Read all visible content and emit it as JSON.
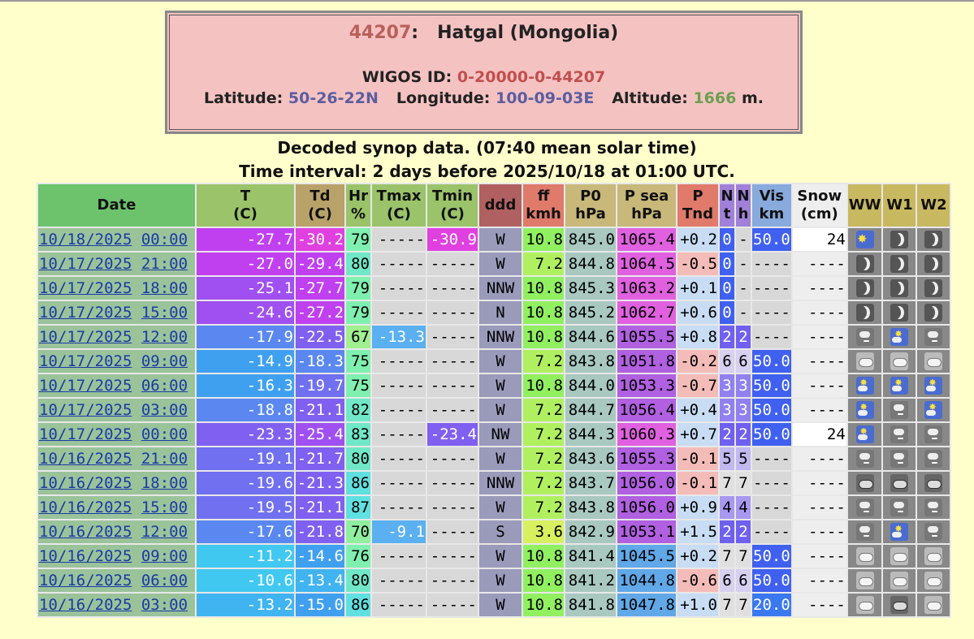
{
  "station": {
    "code": "44207",
    "separator": ":",
    "name": "Hatgal (Mongolia)",
    "wigos_label": "WIGOS ID:",
    "wigos_id": "0-20000-0-44207",
    "lat_label": "Latitude:",
    "lat": "50-26-22N",
    "lon_label": "Longitude:",
    "lon": "100-09-03E",
    "alt_label": "Altitude:",
    "alt": "1666",
    "alt_unit": "m."
  },
  "subtitle1": "Decoded synop data. (07:40 mean solar time)",
  "subtitle2": "Time interval: 2 days before 2025/10/18 at 01:00 UTC.",
  "headers": {
    "date": "Date",
    "T": [
      "T",
      "(C)"
    ],
    "Td": [
      "Td",
      "(C)"
    ],
    "Hr": [
      "Hr",
      "%"
    ],
    "Tmax": [
      "Tmax",
      "(C)"
    ],
    "Tmin": [
      "Tmin",
      "(C)"
    ],
    "ddd": "ddd",
    "ff": [
      "ff",
      "kmh"
    ],
    "P0": [
      "P0",
      "hPa"
    ],
    "Psea": [
      "P sea",
      "hPa"
    ],
    "PTnd": [
      "P",
      "Tnd"
    ],
    "Nt": [
      "N",
      "t"
    ],
    "Nh": [
      "N",
      "h"
    ],
    "Vis": [
      "Vis",
      "km"
    ],
    "Snow": [
      "Snow",
      "(cm)"
    ],
    "WW": "WW",
    "W1": "W1",
    "W2": "W2"
  },
  "rows": [
    {
      "date": "10/18/2025",
      "time": "00:00",
      "T": "-27.7",
      "Td": "-30.2",
      "Hr": "79",
      "Tmax": "-----",
      "Tmin": "-30.9",
      "ddd": "W",
      "ff": "10.8",
      "P0": "845.0",
      "Psea": "1065.4",
      "PTnd": "+0.2",
      "Nt": "0",
      "Nh": "-",
      "Vis": "50.0",
      "Snow": "24",
      "WW": "sun-icon",
      "W1": "moon-icon",
      "W2": "moon-icon"
    },
    {
      "date": "10/17/2025",
      "time": "21:00",
      "T": "-27.0",
      "Td": "-29.4",
      "Hr": "80",
      "Tmax": "-----",
      "Tmin": "-----",
      "ddd": "W",
      "ff": "7.2",
      "P0": "844.8",
      "Psea": "1064.5",
      "PTnd": "-0.5",
      "Nt": "0",
      "Nh": "-",
      "Vis": "----",
      "Snow": "----",
      "WW": "moon-icon",
      "W1": "moon-icon",
      "W2": "moon-icon"
    },
    {
      "date": "10/17/2025",
      "time": "18:00",
      "T": "-25.1",
      "Td": "-27.7",
      "Hr": "79",
      "Tmax": "-----",
      "Tmin": "-----",
      "ddd": "NNW",
      "ff": "10.8",
      "P0": "845.3",
      "Psea": "1063.2",
      "PTnd": "+0.1",
      "Nt": "0",
      "Nh": "-",
      "Vis": "----",
      "Snow": "----",
      "WW": "moon-icon",
      "W1": "moon-icon",
      "W2": "moon-icon"
    },
    {
      "date": "10/17/2025",
      "time": "15:00",
      "T": "-24.6",
      "Td": "-27.2",
      "Hr": "79",
      "Tmax": "-----",
      "Tmin": "-----",
      "ddd": "N",
      "ff": "10.8",
      "P0": "845.2",
      "Psea": "1062.7",
      "PTnd": "+0.6",
      "Nt": "0",
      "Nh": "-",
      "Vis": "----",
      "Snow": "----",
      "WW": "moon-icon",
      "W1": "moon-icon",
      "W2": "moon-icon"
    },
    {
      "date": "10/17/2025",
      "time": "12:00",
      "T": "-17.9",
      "Td": "-22.5",
      "Hr": "67",
      "Tmax": "-13.3",
      "Tmin": "-----",
      "ddd": "NNW",
      "ff": "10.8",
      "P0": "844.6",
      "Psea": "1055.5",
      "PTnd": "+0.8",
      "Nt": "2",
      "Nh": "2",
      "Vis": "----",
      "Snow": "----",
      "WW": "snow-icon",
      "W1": "sun-snow-icon",
      "W2": "snow-icon"
    },
    {
      "date": "10/17/2025",
      "time": "09:00",
      "T": "-14.9",
      "Td": "-18.3",
      "Hr": "75",
      "Tmax": "-----",
      "Tmin": "-----",
      "ddd": "W",
      "ff": "7.2",
      "P0": "843.8",
      "Psea": "1051.8",
      "PTnd": "-0.2",
      "Nt": "6",
      "Nh": "6",
      "Vis": "50.0",
      "Snow": "----",
      "WW": "cloud-icon",
      "W1": "cloud-icon",
      "W2": "cloud-icon"
    },
    {
      "date": "10/17/2025",
      "time": "06:00",
      "T": "-16.3",
      "Td": "-19.7",
      "Hr": "75",
      "Tmax": "-----",
      "Tmin": "-----",
      "ddd": "W",
      "ff": "10.8",
      "P0": "844.0",
      "Psea": "1053.3",
      "PTnd": "-0.7",
      "Nt": "3",
      "Nh": "3",
      "Vis": "50.0",
      "Snow": "----",
      "WW": "sun-snow-icon",
      "W1": "sun-snow-icon",
      "W2": "sun-snow-icon"
    },
    {
      "date": "10/17/2025",
      "time": "03:00",
      "T": "-18.8",
      "Td": "-21.1",
      "Hr": "82",
      "Tmax": "-----",
      "Tmin": "-----",
      "ddd": "W",
      "ff": "7.2",
      "P0": "844.7",
      "Psea": "1056.4",
      "PTnd": "+0.4",
      "Nt": "3",
      "Nh": "3",
      "Vis": "50.0",
      "Snow": "----",
      "WW": "sun-snow-icon",
      "W1": "snow-icon",
      "W2": "sun-snow-icon"
    },
    {
      "date": "10/17/2025",
      "time": "00:00",
      "T": "-23.3",
      "Td": "-25.4",
      "Hr": "83",
      "Tmax": "-----",
      "Tmin": "-23.4",
      "ddd": "NW",
      "ff": "7.2",
      "P0": "844.3",
      "Psea": "1060.3",
      "PTnd": "+0.7",
      "Nt": "2",
      "Nh": "2",
      "Vis": "50.0",
      "Snow": "24",
      "WW": "sun-snow-icon",
      "W1": "snow-icon",
      "W2": "snow-icon"
    },
    {
      "date": "10/16/2025",
      "time": "21:00",
      "T": "-19.1",
      "Td": "-21.7",
      "Hr": "80",
      "Tmax": "-----",
      "Tmin": "-----",
      "ddd": "W",
      "ff": "7.2",
      "P0": "843.6",
      "Psea": "1055.3",
      "PTnd": "-0.1",
      "Nt": "5",
      "Nh": "5",
      "Vis": "----",
      "Snow": "----",
      "WW": "snow-icon",
      "W1": "snow-icon",
      "W2": "snow-icon"
    },
    {
      "date": "10/16/2025",
      "time": "18:00",
      "T": "-19.6",
      "Td": "-21.3",
      "Hr": "86",
      "Tmax": "-----",
      "Tmin": "-----",
      "ddd": "NNW",
      "ff": "7.2",
      "P0": "843.7",
      "Psea": "1056.0",
      "PTnd": "-0.1",
      "Nt": "7",
      "Nh": "7",
      "Vis": "----",
      "Snow": "----",
      "WW": "dark-cloud-icon",
      "W1": "dark-cloud-icon",
      "W2": "dark-cloud-icon"
    },
    {
      "date": "10/16/2025",
      "time": "15:00",
      "T": "-19.5",
      "Td": "-21.1",
      "Hr": "87",
      "Tmax": "-----",
      "Tmin": "-----",
      "ddd": "W",
      "ff": "7.2",
      "P0": "843.8",
      "Psea": "1056.0",
      "PTnd": "+0.9",
      "Nt": "4",
      "Nh": "4",
      "Vis": "----",
      "Snow": "----",
      "WW": "snow-icon",
      "W1": "snow-icon",
      "W2": "snow-icon"
    },
    {
      "date": "10/16/2025",
      "time": "12:00",
      "T": "-17.6",
      "Td": "-21.8",
      "Hr": "70",
      "Tmax": "-9.1",
      "Tmin": "-----",
      "ddd": "S",
      "ff": "3.6",
      "P0": "842.9",
      "Psea": "1053.1",
      "PTnd": "+1.5",
      "Nt": "2",
      "Nh": "2",
      "Vis": "----",
      "Snow": "----",
      "WW": "snow-icon",
      "W1": "sun-snow-icon",
      "W2": "snow-icon"
    },
    {
      "date": "10/16/2025",
      "time": "09:00",
      "T": "-11.2",
      "Td": "-14.6",
      "Hr": "76",
      "Tmax": "-----",
      "Tmin": "-----",
      "ddd": "W",
      "ff": "10.8",
      "P0": "841.4",
      "Psea": "1045.5",
      "PTnd": "+0.2",
      "Nt": "7",
      "Nh": "7",
      "Vis": "50.0",
      "Snow": "----",
      "WW": "cloud-icon",
      "W1": "cloud-icon",
      "W2": "cloud-icon"
    },
    {
      "date": "10/16/2025",
      "time": "06:00",
      "T": "-10.6",
      "Td": "-13.4",
      "Hr": "80",
      "Tmax": "-----",
      "Tmin": "-----",
      "ddd": "W",
      "ff": "10.8",
      "P0": "841.2",
      "Psea": "1044.8",
      "PTnd": "-0.6",
      "Nt": "6",
      "Nh": "6",
      "Vis": "50.0",
      "Snow": "----",
      "WW": "cloud-icon",
      "W1": "cloud-icon",
      "W2": "cloud-icon"
    },
    {
      "date": "10/16/2025",
      "time": "03:00",
      "T": "-13.2",
      "Td": "-15.0",
      "Hr": "86",
      "Tmax": "-----",
      "Tmin": "-----",
      "ddd": "W",
      "ff": "10.8",
      "P0": "841.8",
      "Psea": "1047.8",
      "PTnd": "+1.0",
      "Nt": "7",
      "Nh": "7",
      "Vis": "20.0",
      "Snow": "----",
      "WW": "cloud-icon",
      "W1": "dark-cloud-icon",
      "W2": "cloud-icon"
    }
  ]
}
